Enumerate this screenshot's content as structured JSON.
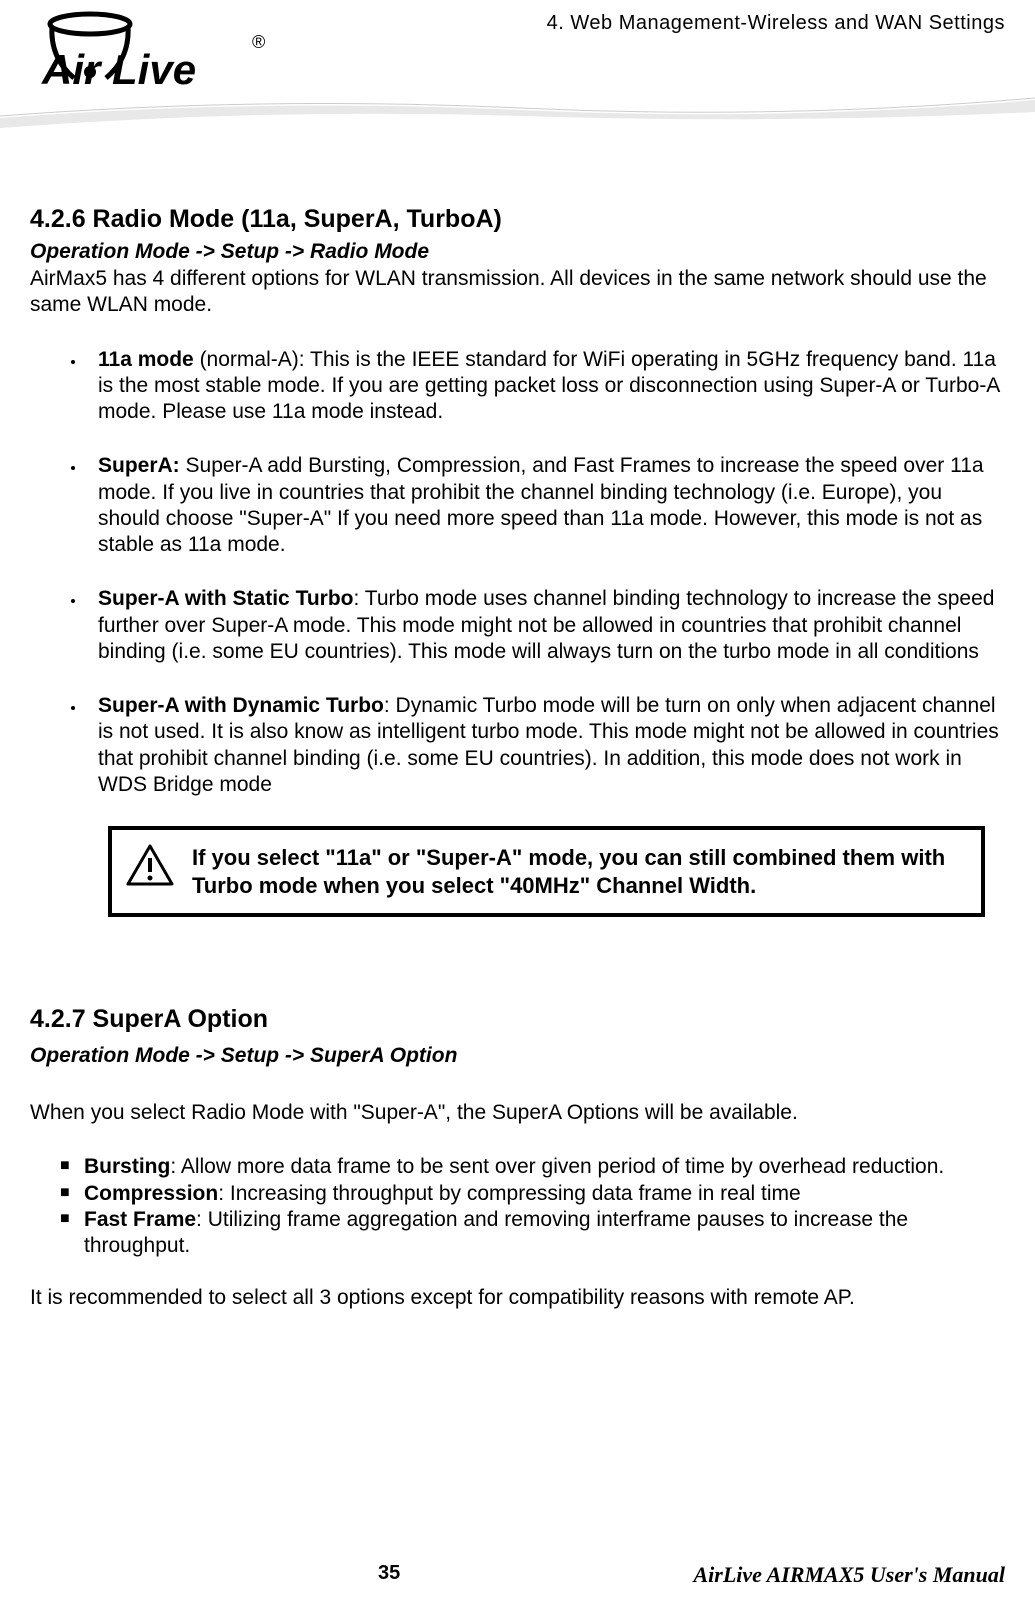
{
  "header": {
    "logo_text": "Air Live",
    "chapter": "4. Web Management-Wireless and WAN Settings"
  },
  "section1": {
    "heading": "4.2.6 Radio Mode (11a, SuperA, TurboA)",
    "breadcrumb": "Operation Mode -> Setup -> Radio Mode",
    "intro": "AirMax5 has 4 different options for WLAN transmission.   All devices in the same network should use the same WLAN mode.",
    "items": [
      {
        "bold": "11a mode",
        "after_bold": " (normal-A): This is the IEEE standard for WiFi operating in 5GHz frequency band. 11a is the most stable mode. If you are getting packet loss or disconnection using Super-A or Turbo-A mode. Please use 11a mode instead."
      },
      {
        "bold": "SuperA:",
        "after_bold": " Super-A add Bursting, Compression, and Fast Frames to increase the speed over 11a mode. If you live in countries that prohibit the channel binding technology (i.e. Europe), you should choose \"Super-A\" If you need more speed than 11a mode.   However, this mode is not as stable as 11a mode."
      },
      {
        "bold": "Super-A with Static Turbo",
        "after_bold": ": Turbo mode uses channel binding technology to increase the speed further over Super-A mode. This mode might not be allowed in countries that prohibit channel binding (i.e. some EU countries). This mode will always turn on the turbo mode in all conditions"
      },
      {
        "bold": "Super-A with Dynamic Turbo",
        "after_bold": ": Dynamic Turbo mode will be turn on only when adjacent channel is not used. It is also know as intelligent turbo mode. This mode might not be allowed in countries that prohibit channel binding (i.e. some EU countries).   In addition, this mode does not work in WDS Bridge mode"
      }
    ],
    "note": "If you select \"11a\" or \"Super-A\" mode, you can still combined them with Turbo mode when you select \"40MHz\" Channel Width."
  },
  "section2": {
    "heading": "4.2.7 SuperA Option",
    "breadcrumb": "Operation Mode -> Setup -> SuperA Option",
    "intro": "When you select Radio Mode with \"Super-A\", the SuperA Options will be available.",
    "items": [
      {
        "bold": "Bursting",
        "after_bold": ":   Allow more data frame to be sent over given period of time by overhead reduction."
      },
      {
        "bold": "Compression",
        "after_bold": ":   Increasing throughput by compressing data frame in real time"
      },
      {
        "bold": "Fast Frame",
        "after_bold": ":   Utilizing frame aggregation and removing interframe pauses to increase the throughput."
      }
    ],
    "outro": "It is recommended to select all 3 options except for compatibility reasons with remote AP."
  },
  "footer": {
    "page": "35",
    "manual": "AirLive AIRMAX5 User's Manual"
  }
}
